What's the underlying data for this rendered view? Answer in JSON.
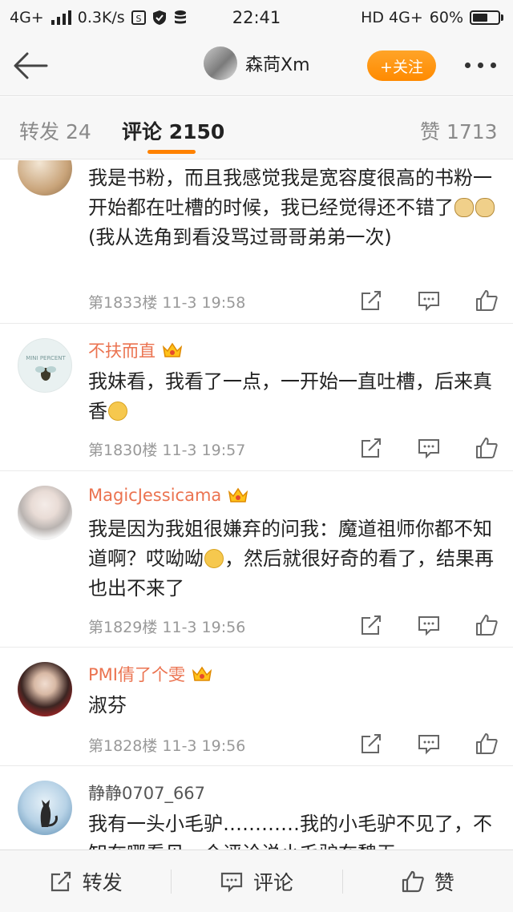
{
  "status": {
    "network_left": "4G+",
    "speed": "0.3K/s",
    "time": "22:41",
    "network_right": "HD 4G+",
    "battery": "60%",
    "battery_level": 0.6
  },
  "header": {
    "name": "森苘Xm",
    "follow_label": "+关注"
  },
  "tabs": {
    "repost": "转发 24",
    "comments": "评论 2150",
    "likes": "赞 1713"
  },
  "comments": [
    {
      "name": "",
      "text_parts": [
        "我是书粉，而且我感觉我是宽容度很高的书粉一开始都在吐槽的时候，我已经觉得还不错了",
        "(我从选角到看没骂过哥哥弟弟一次)"
      ],
      "emojis": [
        "dog",
        "dog"
      ],
      "meta": "第1833楼  11-3 19:58"
    },
    {
      "name": "不扶而直",
      "text_parts": [
        "我妹看，我看了一点，一开始一直吐槽，后来真香",
        ""
      ],
      "emojis": [
        "smile"
      ],
      "meta": "第1830楼  11-3 19:57",
      "avatar_text": "MINI PERCENT"
    },
    {
      "name": "MagicJessicama",
      "text_parts": [
        "我是因为我姐很嫌弃的问我：魔道祖师你都不知道啊？哎呦呦",
        "，然后就很好奇的看了，结果再也出不来了"
      ],
      "emojis": [
        "hehe"
      ],
      "meta": "第1829楼  11-3 19:56"
    },
    {
      "name": "PMI倩了个雯",
      "text_parts": [
        "淑芬",
        ""
      ],
      "emojis": [],
      "meta": "第1828楼  11-3 19:56"
    },
    {
      "name": "静静0707_667",
      "text_parts": [
        "我有一头小毛驴…………我的小毛驴不见了，不知在哪看见一个评论说小毛驴在魏无",
        ""
      ],
      "emojis": [],
      "meta": ""
    }
  ],
  "bottom": {
    "repost": "转发",
    "comment": "评论",
    "like": "赞"
  }
}
